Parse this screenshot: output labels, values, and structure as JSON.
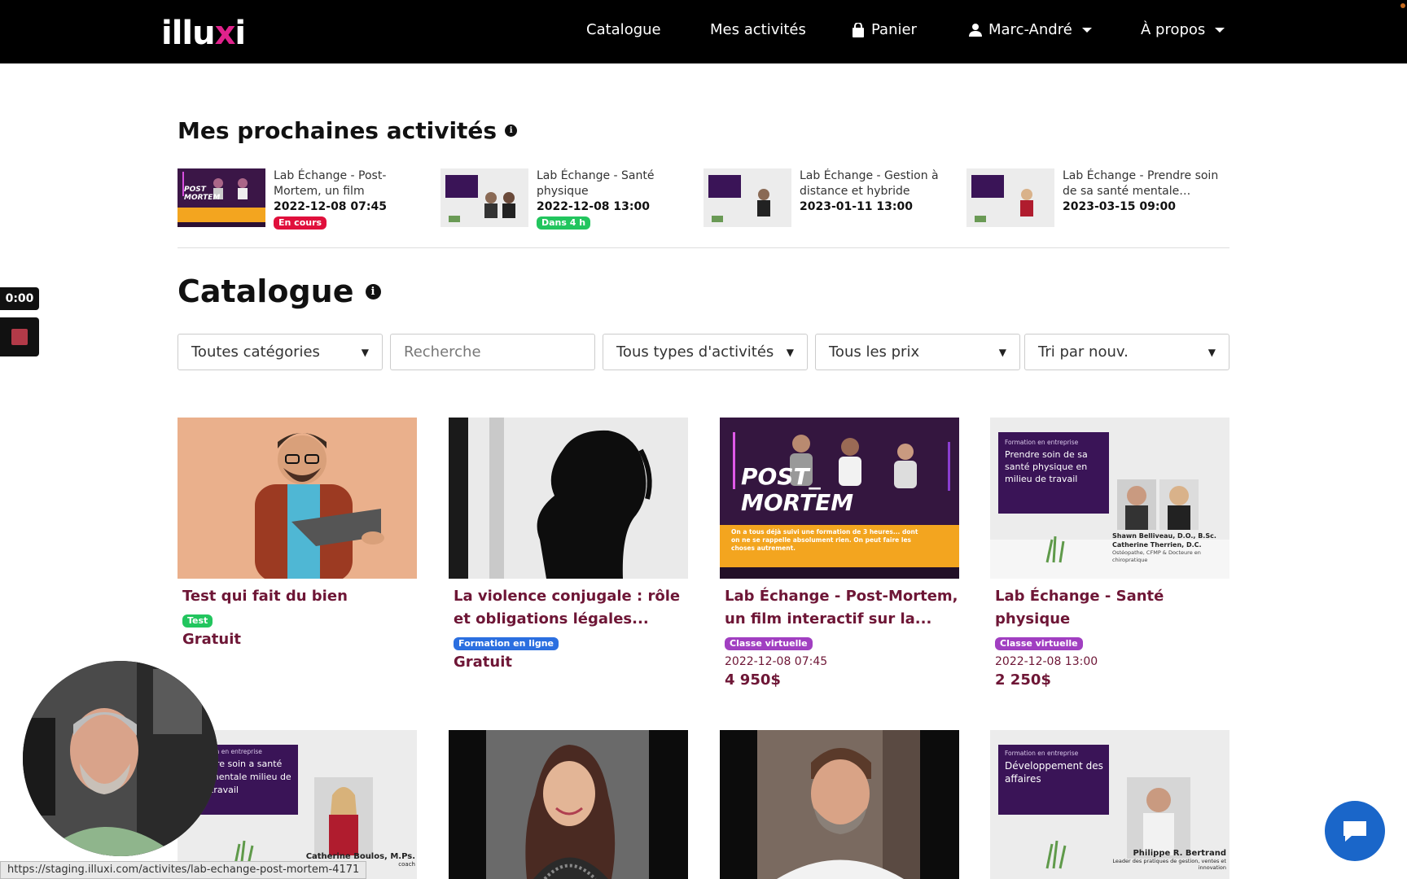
{
  "nav": {
    "logo": "illuxi",
    "catalogue": "Catalogue",
    "activities": "Mes activités",
    "cart": "Panier",
    "user": "Marc-André",
    "about": "À propos"
  },
  "upcoming": {
    "title": "Mes prochaines activités",
    "items": [
      {
        "title": "Lab Échange - Post-Mortem, un film interactif…",
        "date": "2022-12-08 07:45",
        "badge": "En cours",
        "badge_color": "#e0103c"
      },
      {
        "title": "Lab Échange - Santé physique",
        "date": "2022-12-08 13:00",
        "badge": "Dans 4 h",
        "badge_color": "#22c55e"
      },
      {
        "title": "Lab Échange - Gestion à distance et hybride",
        "date": "2023-01-11 13:00",
        "badge": "",
        "badge_color": ""
      },
      {
        "title": "Lab Échange - Prendre soin de sa santé mentale…",
        "date": "2023-03-15 09:00",
        "badge": "",
        "badge_color": ""
      }
    ]
  },
  "catalogue": {
    "title": "Catalogue",
    "filters": {
      "category": "Toutes catégories",
      "search_placeholder": "Recherche",
      "type": "Tous types d'activités",
      "price": "Tous les prix",
      "sort": "Tri par nouv."
    },
    "cards": [
      {
        "title": "Test qui fait du bien",
        "badge": "Test",
        "badge_color": "#22c55e",
        "date": "",
        "price": "Gratuit"
      },
      {
        "title": "La violence conjugale : rôle et obligations légales...",
        "badge": "Formation en ligne",
        "badge_color": "#2b6fe0",
        "date": "",
        "price": "Gratuit"
      },
      {
        "title": "Lab Échange - Post-Mortem, un film interactif sur la...",
        "badge": "Classe virtuelle",
        "badge_color": "#a13fc1",
        "date": "2022-12-08 07:45",
        "price": "4 950$"
      },
      {
        "title": "Lab Échange - Santé physique",
        "badge": "Classe virtuelle",
        "badge_color": "#a13fc1",
        "date": "2022-12-08 13:00",
        "price": "2 250$"
      }
    ],
    "thumb_texts": {
      "postmortem_1": "POST_",
      "postmortem_2": "MORTEM",
      "postmortem_sub": "On a tous déjà suivi une formation de 3 heures... dont on ne se rappelle absolument rien. On peut faire les choses autrement.",
      "sante_kicker": "Formation en entreprise",
      "sante_title": "Prendre soin de sa santé physique en milieu de travail",
      "sante_names": "Shawn Belliveau, D.O., B.Sc. Catherine Therrien, D.C.",
      "sante_roles": "Ostéopathe, CFMP & Docteure en chiropratique",
      "mentale_kicker": "ion en entreprise",
      "mentale_title": "dre soin a santé mentale milieu de travail",
      "mentale_name": "Catherine Boulos, M.Ps.",
      "mentale_role": "coach",
      "dev_kicker": "Formation en entreprise",
      "dev_title": "Développement des affaires",
      "dev_name": "Philippe R. Bertrand",
      "dev_role": "Leader des pratiques de gestion, ventes et innovation"
    }
  },
  "recorder": {
    "time": "0:00"
  },
  "status_url": "https://staging.illuxi.com/activites/lab-echange-post-mortem-4171"
}
